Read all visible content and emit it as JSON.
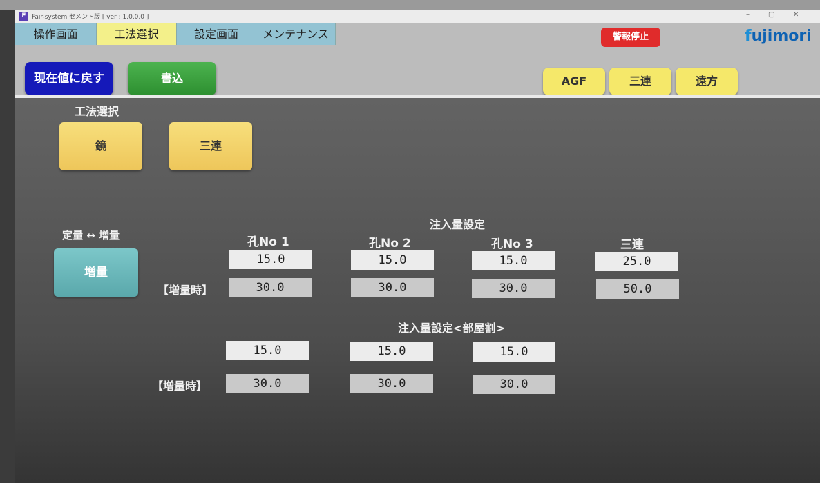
{
  "window": {
    "app_icon": "F",
    "title": "Fair-system セメント版 [ ver : 1.0.0.0 ]",
    "minimize": "–",
    "maximize": "▢",
    "close": "✕"
  },
  "tabs": [
    {
      "label": "操作画面",
      "active": false
    },
    {
      "label": "工法選択",
      "active": true
    },
    {
      "label": "設定画面",
      "active": false
    },
    {
      "label": "メンテナンス",
      "active": false
    }
  ],
  "alarm_stop": "警報停止",
  "logo": {
    "mark": "f",
    "text": "ujimori"
  },
  "toolbar": {
    "reset_label": "現在値に戻す",
    "write_label": "書込",
    "agf_label": "AGF",
    "sanren_label": "三連",
    "enpou_label": "遠方"
  },
  "method": {
    "title": "工法選択",
    "kagami": "鏡",
    "sanren": "三連"
  },
  "mode": {
    "title": "定量 ↔ 増量",
    "button": "増量"
  },
  "injection": {
    "title": "注入量設定",
    "columns": [
      "孔No 1",
      "孔No 2",
      "孔No 3",
      "三連"
    ],
    "row_label": "【増量時】",
    "normal": [
      "15.0",
      "15.0",
      "15.0",
      "25.0"
    ],
    "increased": [
      "30.0",
      "30.0",
      "30.0",
      "50.0"
    ]
  },
  "room": {
    "title": "注入量設定<部屋割>",
    "row_label": "【増量時】",
    "normal": [
      "15.0",
      "15.0",
      "15.0"
    ],
    "increased": [
      "30.0",
      "30.0",
      "30.0"
    ]
  }
}
